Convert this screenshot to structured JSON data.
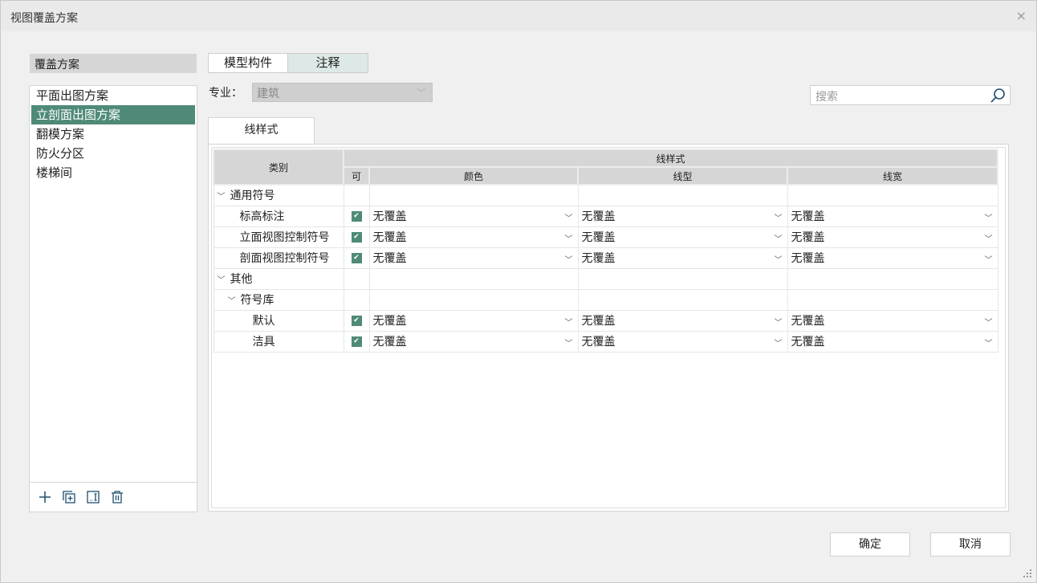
{
  "window": {
    "title": "视图覆盖方案",
    "close": "×"
  },
  "left": {
    "header": "覆盖方案",
    "items": [
      "平面出图方案",
      "立剖面出图方案",
      "翻模方案",
      "防火分区",
      "楼梯间"
    ],
    "selected_index": 1
  },
  "tabs": [
    {
      "label": "模型构件",
      "active": false
    },
    {
      "label": "注释",
      "active": true
    }
  ],
  "spec": {
    "label": "专业：",
    "value": "建筑"
  },
  "search": {
    "placeholder": "搜索"
  },
  "subtab": "线样式",
  "table": {
    "headers": {
      "category": "类别",
      "group": "线样式",
      "visible": "可",
      "color": "颜色",
      "linetype": "线型",
      "linewidth": "线宽"
    },
    "rows": [
      {
        "name": "通用符号",
        "level": 0,
        "group": true
      },
      {
        "name": "标高标注",
        "level": 1,
        "checked": true,
        "color": "无覆盖",
        "linetype": "无覆盖",
        "linewidth": "无覆盖"
      },
      {
        "name": "立面视图控制符号",
        "level": 1,
        "checked": true,
        "color": "无覆盖",
        "linetype": "无覆盖",
        "linewidth": "无覆盖"
      },
      {
        "name": "剖面视图控制符号",
        "level": 1,
        "checked": true,
        "color": "无覆盖",
        "linetype": "无覆盖",
        "linewidth": "无覆盖"
      },
      {
        "name": "其他",
        "level": 0,
        "group": true
      },
      {
        "name": "符号库",
        "level": 1,
        "group": true
      },
      {
        "name": "默认",
        "level": 2,
        "checked": true,
        "color": "无覆盖",
        "linetype": "无覆盖",
        "linewidth": "无覆盖"
      },
      {
        "name": "洁具",
        "level": 2,
        "checked": true,
        "color": "无覆盖",
        "linetype": "无覆盖",
        "linewidth": "无覆盖"
      }
    ]
  },
  "buttons": {
    "ok": "确定",
    "cancel": "取消"
  },
  "colors": {
    "accent": "#4f8a78",
    "icon": "#1e4e6e"
  }
}
